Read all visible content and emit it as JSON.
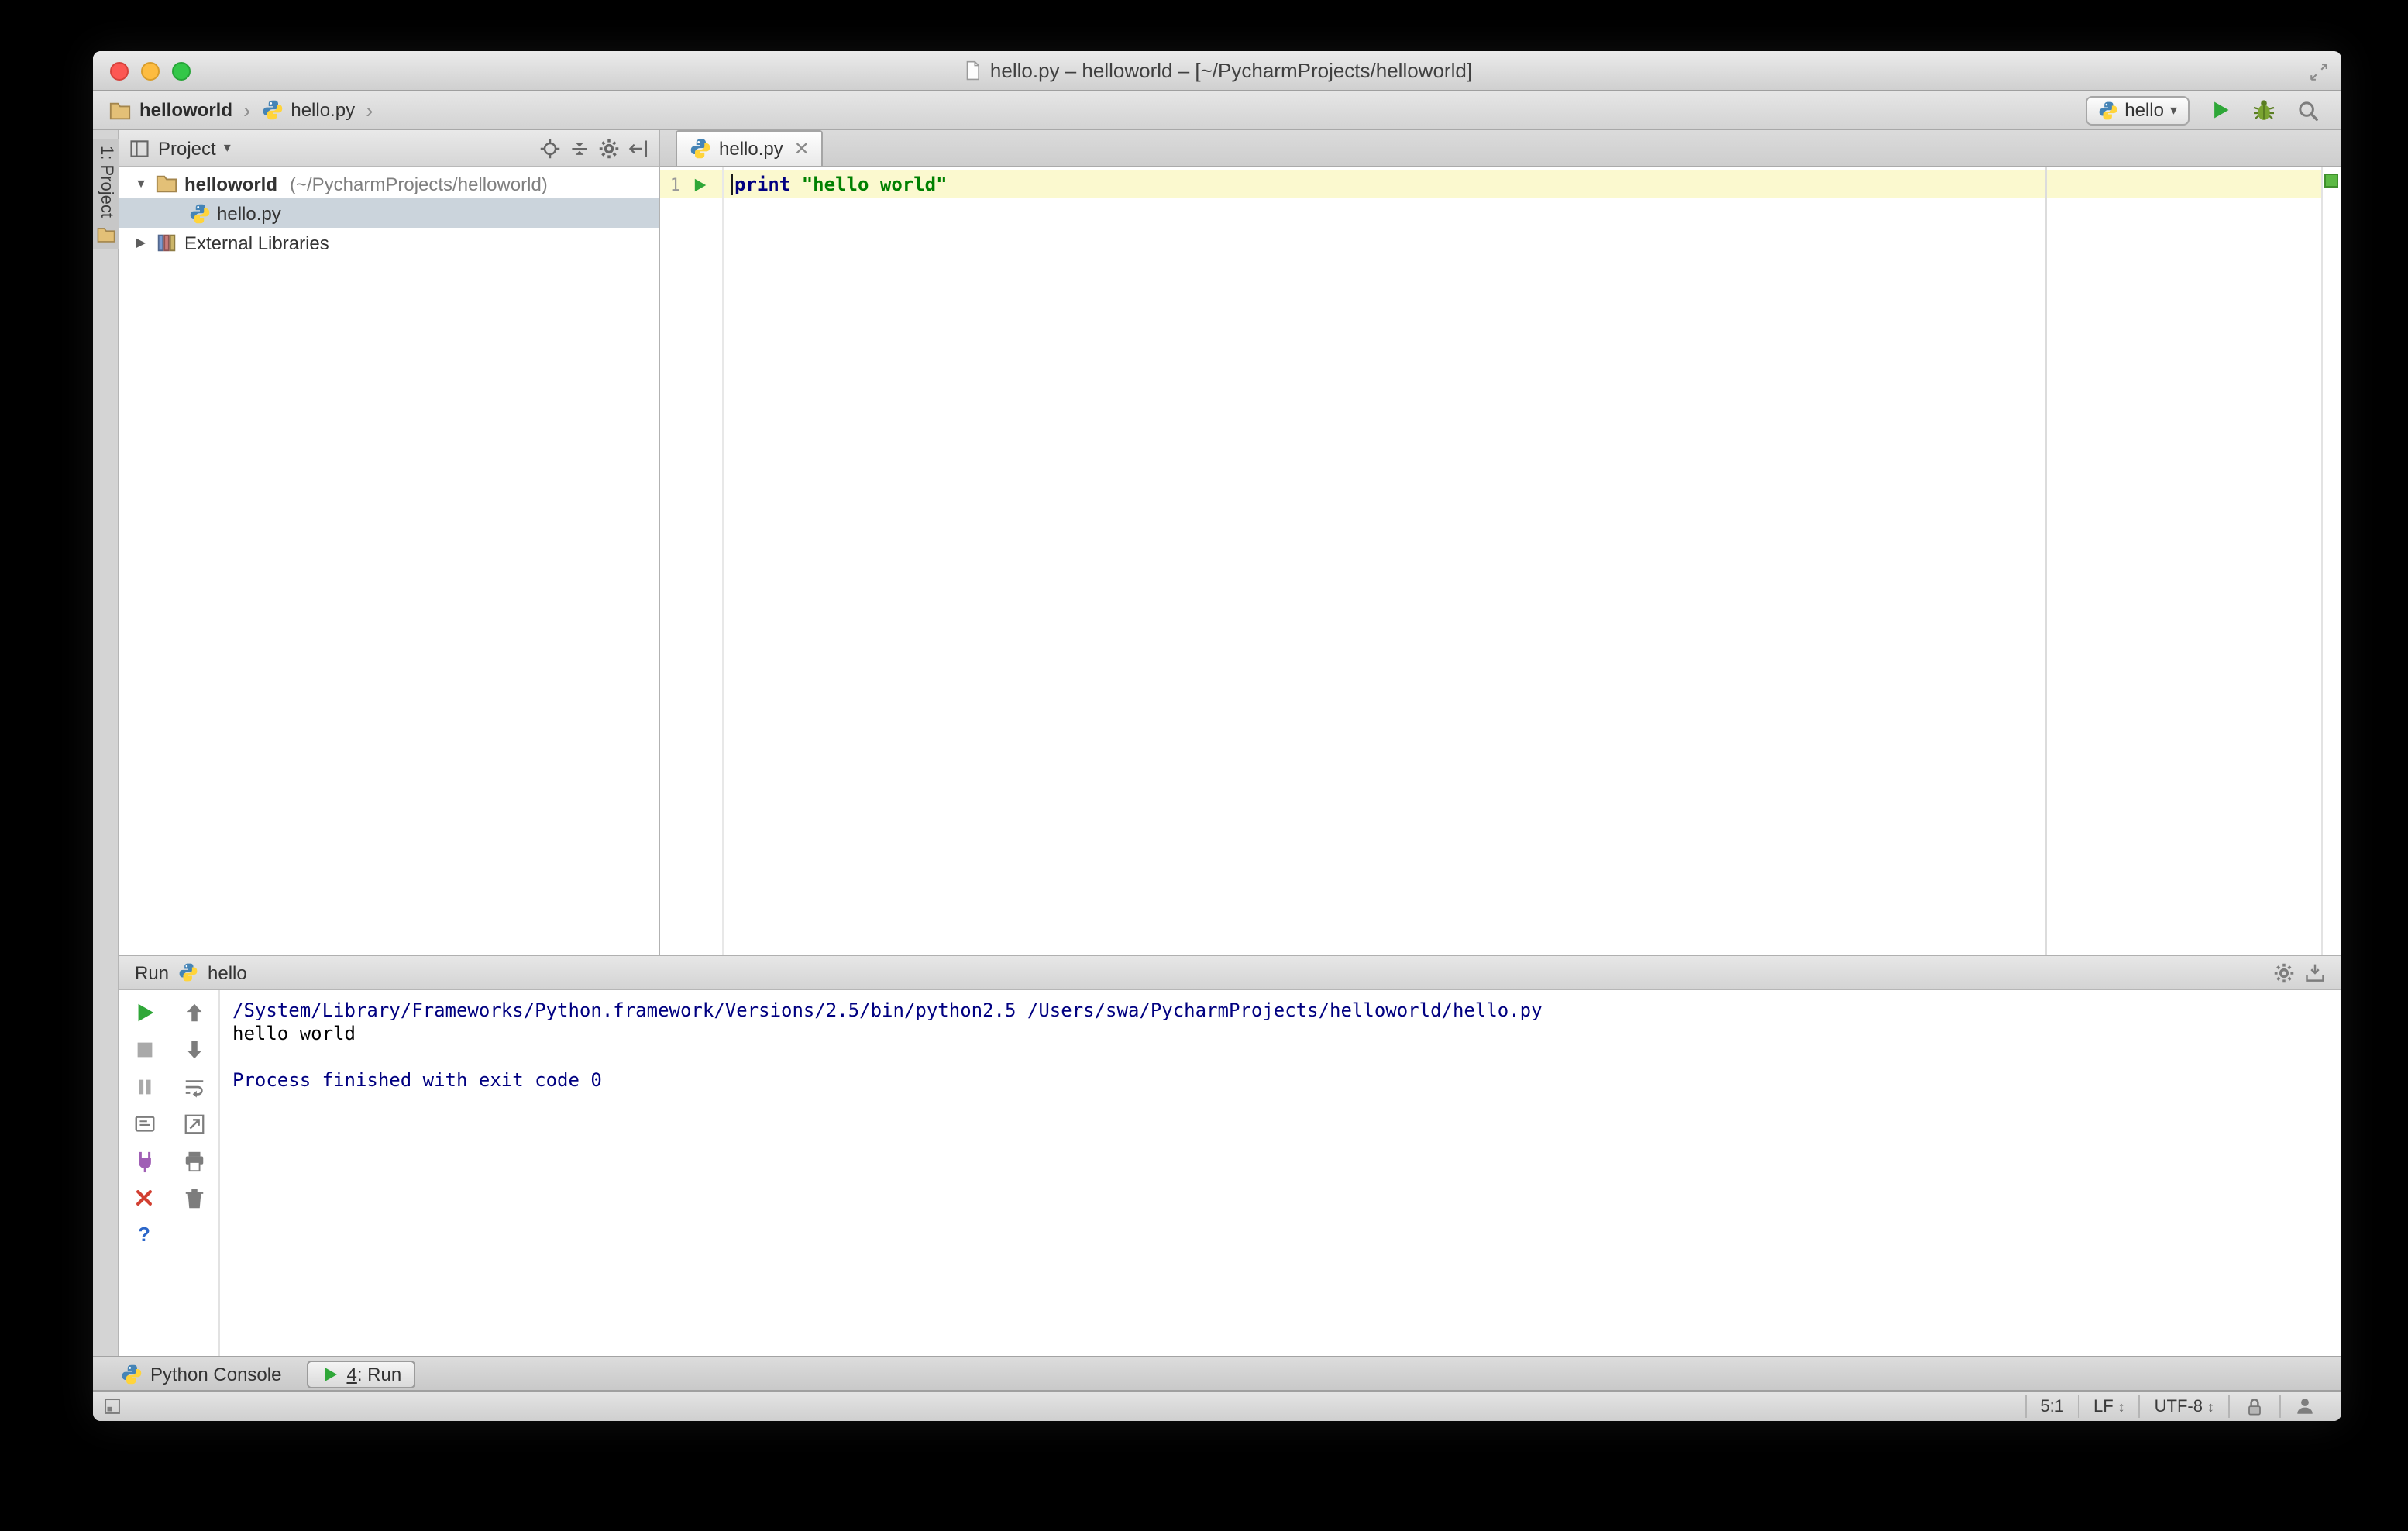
{
  "window": {
    "title": "hello.py – helloworld – [~/PycharmProjects/helloworld]"
  },
  "navbar": {
    "crumb_project": "helloworld",
    "crumb_file": "hello.py",
    "run_config_label": "hello"
  },
  "stripe": {
    "project_button": "1: Project"
  },
  "project_panel": {
    "header_label": "Project",
    "root_name": "helloworld",
    "root_path": "(~/PycharmProjects/helloworld)",
    "file_name": "hello.py",
    "external_libraries": "External Libraries"
  },
  "editor": {
    "tab_label": "hello.py",
    "line_number": "1",
    "keyword": "print",
    "string": "\"hello world\""
  },
  "run_panel": {
    "header_label": "Run",
    "config_label": "hello",
    "lines": [
      {
        "text": "/System/Library/Frameworks/Python.framework/Versions/2.5/bin/python2.5 /Users/swa/PycharmProjects/helloworld/hello.py"
      },
      {
        "text": "hello world"
      },
      {
        "text": ""
      },
      {
        "text": "Process finished with exit code 0"
      }
    ]
  },
  "bottom_bar": {
    "python_console_label": "Python Console",
    "run_tab_number": "4",
    "run_tab_suffix": ": Run",
    "help_label": "?"
  },
  "status_bar": {
    "caret_position": "5:1",
    "line_separator": "LF",
    "encoding": "UTF-8"
  },
  "icons": {
    "run": "green-play-triangle",
    "debug": "bug",
    "search": "magnifier",
    "settings": "gear",
    "project_folder": "tan-folder",
    "python_file": "python-logo",
    "inspection_status": "green-square",
    "lock": "padlock"
  },
  "colors": {
    "keyword": "#000080",
    "string": "#008000",
    "console_system_text": "#000080",
    "run_green": "#2fa738",
    "caret_line_highlight": "#fbf9cf",
    "selection_row": "#cbd4dc"
  }
}
